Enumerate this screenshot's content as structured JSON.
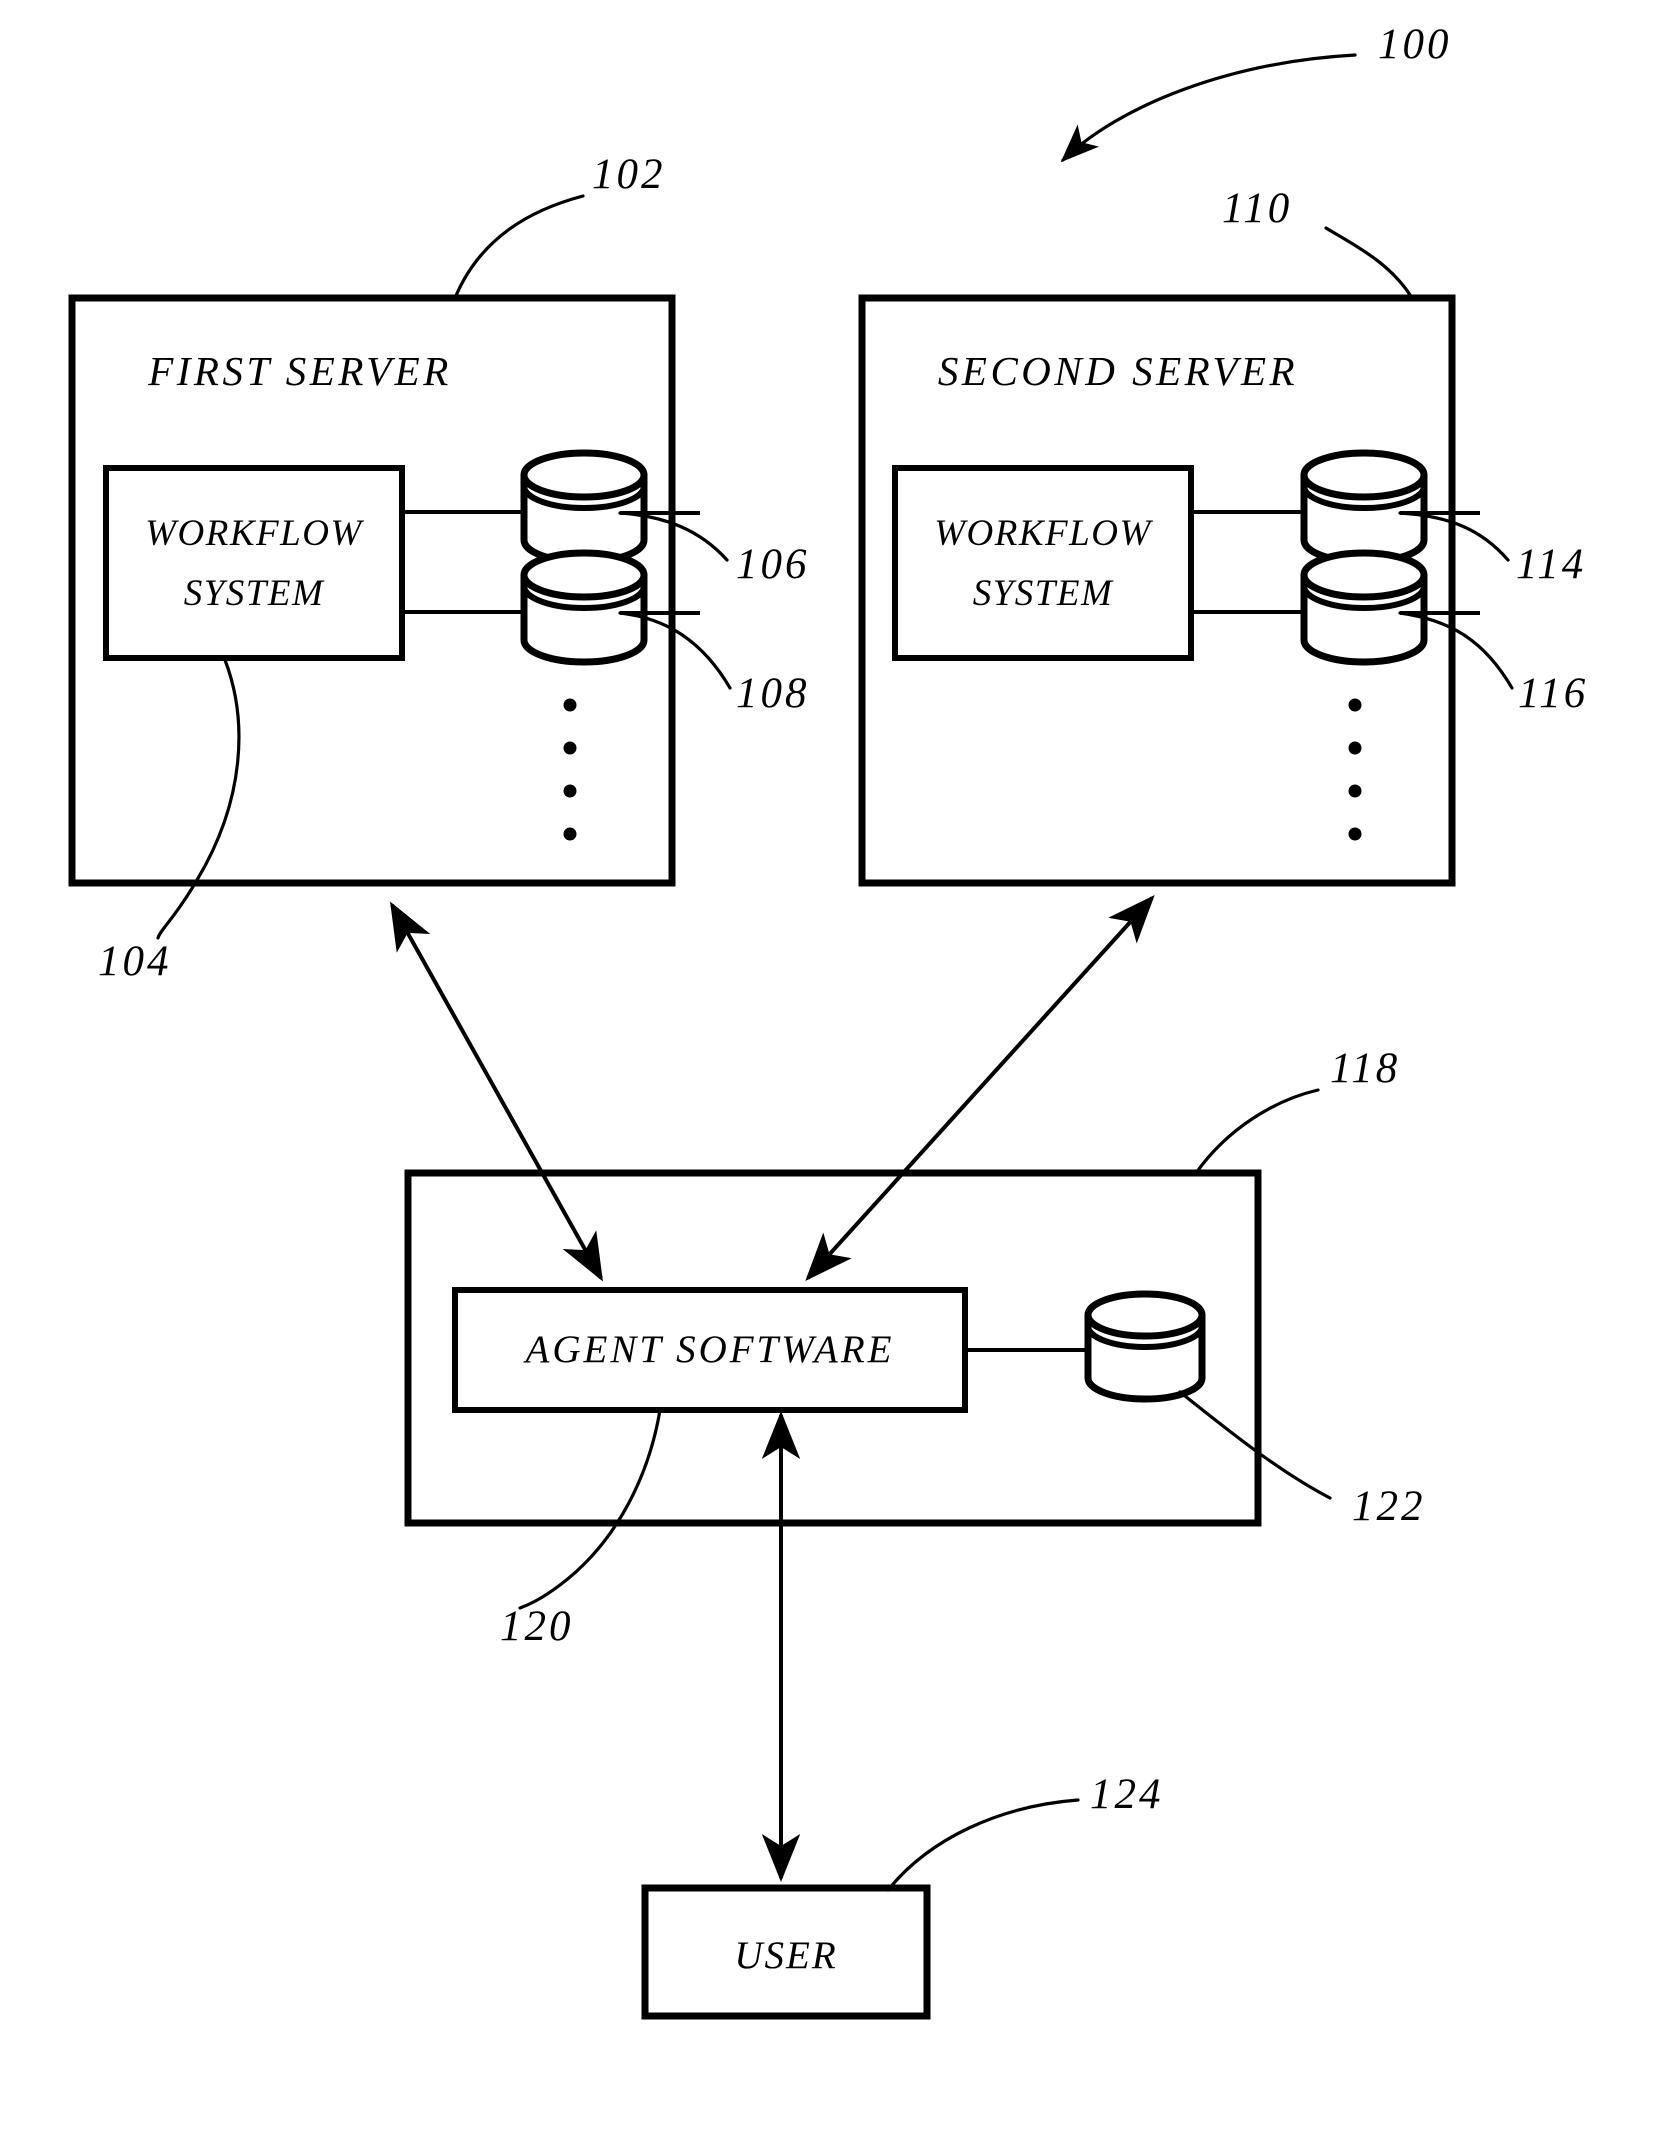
{
  "figure": {
    "figure_number": "100",
    "blocks": {
      "first_server": {
        "title": "FIRST SERVER",
        "ref": "102",
        "workflow_label_line1": "WORKFLOW",
        "workflow_label_line2": "SYSTEM",
        "workflow_ref": "104",
        "db_top_ref": "106",
        "db_bottom_ref": "108"
      },
      "second_server": {
        "title": "SECOND SERVER",
        "ref": "110",
        "workflow_label_line1": "WORKFLOW",
        "workflow_label_line2": "SYSTEM",
        "db_top_ref": "114",
        "db_bottom_ref": "116"
      },
      "agent_container": {
        "ref": "118",
        "agent_label": "AGENT SOFTWARE",
        "agent_ref": "120",
        "db_ref": "122"
      },
      "user": {
        "label": "USER",
        "ref": "124"
      }
    }
  }
}
